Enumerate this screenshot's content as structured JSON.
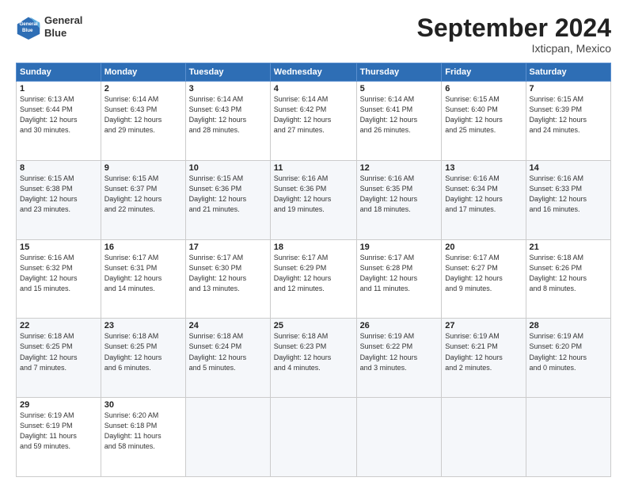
{
  "header": {
    "logo_line1": "General",
    "logo_line2": "Blue",
    "month_title": "September 2024",
    "location": "Ixticpan, Mexico"
  },
  "weekdays": [
    "Sunday",
    "Monday",
    "Tuesday",
    "Wednesday",
    "Thursday",
    "Friday",
    "Saturday"
  ],
  "weeks": [
    [
      {
        "day": "1",
        "info": "Sunrise: 6:13 AM\nSunset: 6:44 PM\nDaylight: 12 hours\nand 30 minutes."
      },
      {
        "day": "2",
        "info": "Sunrise: 6:14 AM\nSunset: 6:43 PM\nDaylight: 12 hours\nand 29 minutes."
      },
      {
        "day": "3",
        "info": "Sunrise: 6:14 AM\nSunset: 6:43 PM\nDaylight: 12 hours\nand 28 minutes."
      },
      {
        "day": "4",
        "info": "Sunrise: 6:14 AM\nSunset: 6:42 PM\nDaylight: 12 hours\nand 27 minutes."
      },
      {
        "day": "5",
        "info": "Sunrise: 6:14 AM\nSunset: 6:41 PM\nDaylight: 12 hours\nand 26 minutes."
      },
      {
        "day": "6",
        "info": "Sunrise: 6:15 AM\nSunset: 6:40 PM\nDaylight: 12 hours\nand 25 minutes."
      },
      {
        "day": "7",
        "info": "Sunrise: 6:15 AM\nSunset: 6:39 PM\nDaylight: 12 hours\nand 24 minutes."
      }
    ],
    [
      {
        "day": "8",
        "info": "Sunrise: 6:15 AM\nSunset: 6:38 PM\nDaylight: 12 hours\nand 23 minutes."
      },
      {
        "day": "9",
        "info": "Sunrise: 6:15 AM\nSunset: 6:37 PM\nDaylight: 12 hours\nand 22 minutes."
      },
      {
        "day": "10",
        "info": "Sunrise: 6:15 AM\nSunset: 6:36 PM\nDaylight: 12 hours\nand 21 minutes."
      },
      {
        "day": "11",
        "info": "Sunrise: 6:16 AM\nSunset: 6:36 PM\nDaylight: 12 hours\nand 19 minutes."
      },
      {
        "day": "12",
        "info": "Sunrise: 6:16 AM\nSunset: 6:35 PM\nDaylight: 12 hours\nand 18 minutes."
      },
      {
        "day": "13",
        "info": "Sunrise: 6:16 AM\nSunset: 6:34 PM\nDaylight: 12 hours\nand 17 minutes."
      },
      {
        "day": "14",
        "info": "Sunrise: 6:16 AM\nSunset: 6:33 PM\nDaylight: 12 hours\nand 16 minutes."
      }
    ],
    [
      {
        "day": "15",
        "info": "Sunrise: 6:16 AM\nSunset: 6:32 PM\nDaylight: 12 hours\nand 15 minutes."
      },
      {
        "day": "16",
        "info": "Sunrise: 6:17 AM\nSunset: 6:31 PM\nDaylight: 12 hours\nand 14 minutes."
      },
      {
        "day": "17",
        "info": "Sunrise: 6:17 AM\nSunset: 6:30 PM\nDaylight: 12 hours\nand 13 minutes."
      },
      {
        "day": "18",
        "info": "Sunrise: 6:17 AM\nSunset: 6:29 PM\nDaylight: 12 hours\nand 12 minutes."
      },
      {
        "day": "19",
        "info": "Sunrise: 6:17 AM\nSunset: 6:28 PM\nDaylight: 12 hours\nand 11 minutes."
      },
      {
        "day": "20",
        "info": "Sunrise: 6:17 AM\nSunset: 6:27 PM\nDaylight: 12 hours\nand 9 minutes."
      },
      {
        "day": "21",
        "info": "Sunrise: 6:18 AM\nSunset: 6:26 PM\nDaylight: 12 hours\nand 8 minutes."
      }
    ],
    [
      {
        "day": "22",
        "info": "Sunrise: 6:18 AM\nSunset: 6:25 PM\nDaylight: 12 hours\nand 7 minutes."
      },
      {
        "day": "23",
        "info": "Sunrise: 6:18 AM\nSunset: 6:25 PM\nDaylight: 12 hours\nand 6 minutes."
      },
      {
        "day": "24",
        "info": "Sunrise: 6:18 AM\nSunset: 6:24 PM\nDaylight: 12 hours\nand 5 minutes."
      },
      {
        "day": "25",
        "info": "Sunrise: 6:18 AM\nSunset: 6:23 PM\nDaylight: 12 hours\nand 4 minutes."
      },
      {
        "day": "26",
        "info": "Sunrise: 6:19 AM\nSunset: 6:22 PM\nDaylight: 12 hours\nand 3 minutes."
      },
      {
        "day": "27",
        "info": "Sunrise: 6:19 AM\nSunset: 6:21 PM\nDaylight: 12 hours\nand 2 minutes."
      },
      {
        "day": "28",
        "info": "Sunrise: 6:19 AM\nSunset: 6:20 PM\nDaylight: 12 hours\nand 0 minutes."
      }
    ],
    [
      {
        "day": "29",
        "info": "Sunrise: 6:19 AM\nSunset: 6:19 PM\nDaylight: 11 hours\nand 59 minutes."
      },
      {
        "day": "30",
        "info": "Sunrise: 6:20 AM\nSunset: 6:18 PM\nDaylight: 11 hours\nand 58 minutes."
      },
      null,
      null,
      null,
      null,
      null
    ]
  ]
}
